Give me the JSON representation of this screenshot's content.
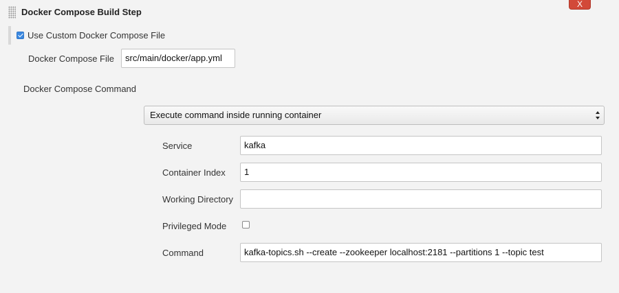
{
  "step": {
    "title": "Docker Compose Build Step",
    "close_label": "X"
  },
  "custom_file": {
    "checkbox_label": "Use Custom Docker Compose File",
    "checked": true,
    "file_label": "Docker Compose File",
    "file_value": "src/main/docker/app.yml"
  },
  "command_section": {
    "label": "Docker Compose Command",
    "selected_option": "Execute command inside running container"
  },
  "exec": {
    "service_label": "Service",
    "service_value": "kafka",
    "container_index_label": "Container Index",
    "container_index_value": "1",
    "working_directory_label": "Working Directory",
    "working_directory_value": "",
    "privileged_label": "Privileged Mode",
    "privileged_checked": false,
    "command_label": "Command",
    "command_value": "kafka-topics.sh --create --zookeeper localhost:2181 --partitions 1 --topic test"
  },
  "colors": {
    "background": "#f3f3f3",
    "close_button": "#d24939",
    "checkbox_checked": "#3b88e0"
  }
}
